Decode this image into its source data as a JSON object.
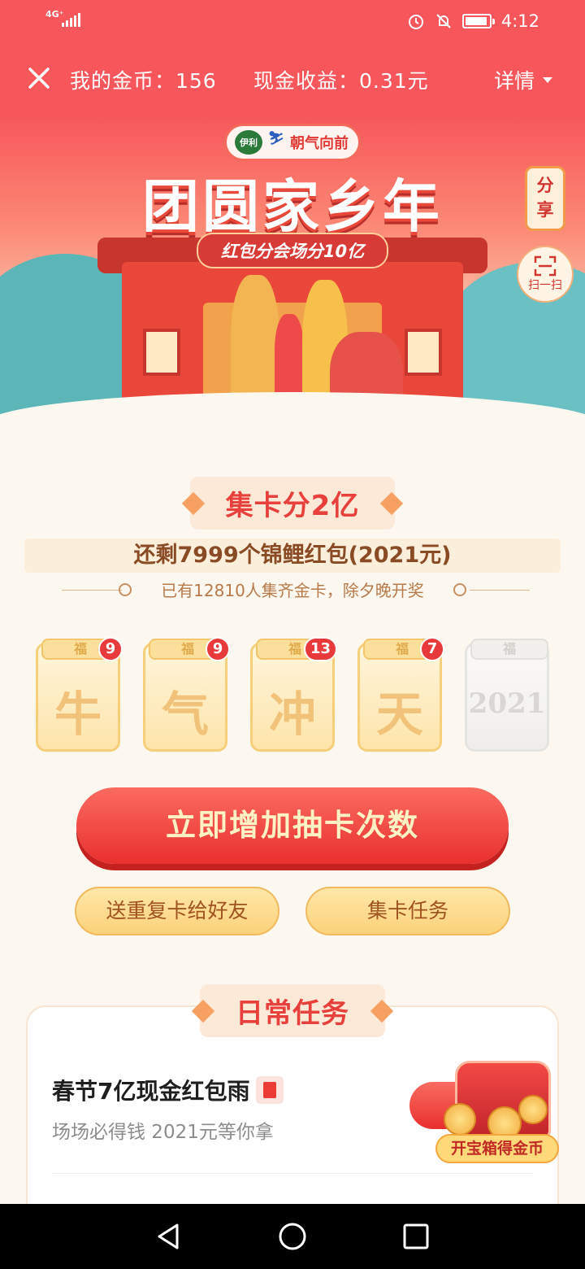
{
  "status_bar": {
    "network": "4G⁺",
    "time": "4:12"
  },
  "header": {
    "coins_label": "我的金币：156",
    "cash_label": "现金收益：0.31元",
    "detail_label": "详情"
  },
  "hero": {
    "sponsor_logo_text": "伊利",
    "sponsor_slogan": "朝气向前",
    "title": "团圆家乡年",
    "subtitle": "红包分会场分10亿",
    "share_label": "分享",
    "share_label_line1": "分",
    "share_label_line2": "享",
    "scan_label": "扫一扫"
  },
  "collect": {
    "section_title": "集卡分2亿",
    "remaining_text": "还剩7999个锦鲤红包(2021元)",
    "notice_text": "已有12810人集齐金卡，除夕晚开奖",
    "cards": [
      {
        "char": "牛",
        "count": "9"
      },
      {
        "char": "气",
        "count": "9"
      },
      {
        "char": "冲",
        "count": "13"
      },
      {
        "char": "天",
        "count": "7"
      },
      {
        "char": "2021",
        "count": ""
      }
    ],
    "cta_label": "立即增加抽卡次数",
    "gift_button_label": "送重复卡给好友",
    "task_button_label": "集卡任务"
  },
  "daily": {
    "section_title": "日常任务",
    "task_title": "春节7亿现金红包雨",
    "task_subtitle": "场场必得钱 2021元等你拿",
    "chest_label": "开宝箱得金币"
  },
  "colors": {
    "primary": "#f7575a",
    "accent_red": "#e8302e",
    "gold": "#fbd27a",
    "background": "#fdf8ef"
  },
  "icons": [
    "close-icon",
    "caret-down-icon",
    "alarm-icon",
    "mute-icon",
    "battery-icon",
    "scan-icon",
    "envelope-icon",
    "back-icon",
    "home-icon",
    "recents-icon"
  ]
}
